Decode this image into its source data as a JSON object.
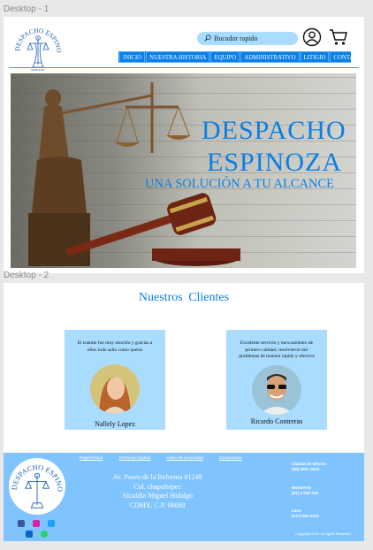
{
  "frames": {
    "desktop1": "Desktop - 1",
    "desktop2": "Desktop - 2"
  },
  "logo": {
    "ring_text": "DESPACHO ESPINOZA",
    "small_text": "ESPINOZA"
  },
  "search": {
    "placeholder": "Bucador rapido",
    "icon": "search-icon"
  },
  "header_icons": [
    "user-icon",
    "cart-icon"
  ],
  "nav": {
    "items": [
      {
        "label": "INICIO"
      },
      {
        "label": "NUESTRA HISTORIA"
      },
      {
        "label": "EQUIPO"
      },
      {
        "label": "ADMINISTRATIVO"
      },
      {
        "label": "LITIGIO"
      },
      {
        "label": "CONTACTO"
      }
    ]
  },
  "hero": {
    "title_line1": "DESPACHO",
    "title_line2": "ESPINOZA",
    "subtitle": "UNA SOLUCIÓN A TU ALCANCE"
  },
  "clients": {
    "title": "Nuestros Clientes",
    "cards": [
      {
        "quote": "El tramite fue muy sencillo y gracias a ellos todo salio como queria",
        "name": "Nallely Lopez"
      },
      {
        "quote": "Excelente servicio y mexcamiento de primero calidad, resolvieron mir problemas de manera rapido y efectiva",
        "name": "Ricardo Contreras"
      }
    ]
  },
  "footer": {
    "links": [
      "Page/oficina",
      "Terminos legales",
      "Aviso de privacidad",
      "Contactamo"
    ],
    "address": [
      "Av. Paseo de la Reforma #1248",
      "Col. chapultepec",
      "Alcaldia Miguel Hidalgo",
      "CDMX. C.P. 06680"
    ],
    "offices": [
      {
        "city": "Ciudad de México",
        "phone": "(55) 5661 2624"
      },
      {
        "city": "Monterrey",
        "phone": "(81) 2 632 318"
      },
      {
        "city": "Leon",
        "phone": "(477) 964 2741"
      }
    ],
    "copyright": "Copyright 2020. All rights Reserved",
    "social": [
      "facebook-icon",
      "instagram-icon",
      "twitter-icon",
      "linkedin-icon",
      "whatsapp-icon"
    ]
  },
  "colors": {
    "accent": "#0a7fe6",
    "light_blue": "#a9dcff",
    "footer": "#7fc4ff"
  }
}
